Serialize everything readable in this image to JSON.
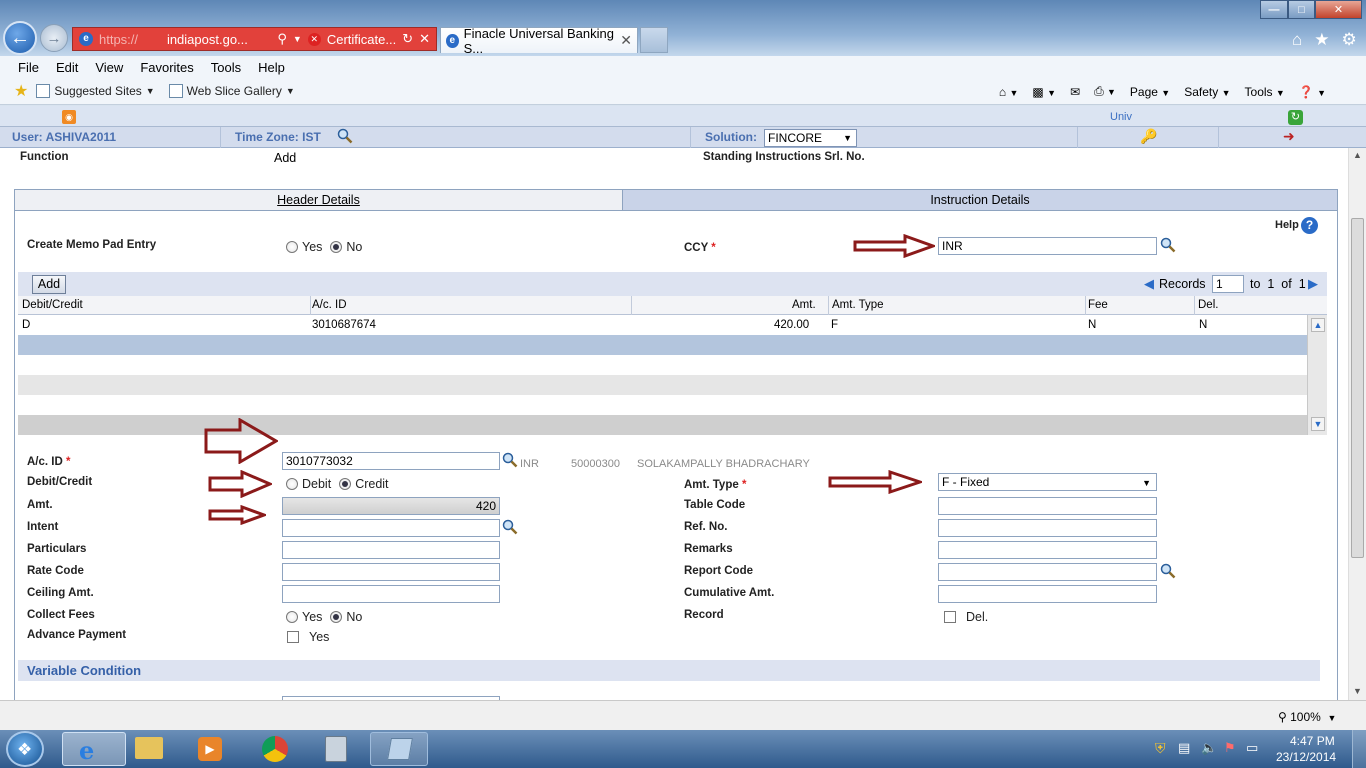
{
  "browser": {
    "address_url_faded": "https://",
    "address_url_host": "indiapost.go...",
    "cert_label": "Certificate...",
    "active_tab_title": "Finacle Universal Banking S...",
    "menu": [
      "File",
      "Edit",
      "View",
      "Favorites",
      "Tools",
      "Help"
    ],
    "favorites": [
      "Suggested Sites",
      "Web Slice Gallery"
    ],
    "commands": [
      "Page",
      "Safety",
      "Tools"
    ],
    "zoom": "100%"
  },
  "app": {
    "univ_link": "Univ",
    "user_label": "User: ASHIVA2011",
    "timezone_label": "Time Zone: IST",
    "solution_label": "Solution:",
    "solution_value": "FINCORE"
  },
  "form": {
    "function_label": "Function",
    "function_value": "Add",
    "si_srl_label": "Standing Instructions Srl. No.",
    "tabs": {
      "header": "Header Details",
      "instruction": "Instruction Details"
    },
    "help_label": "Help",
    "memo_label": "Create Memo Pad Entry",
    "memo_yes": "Yes",
    "memo_no": "No",
    "ccy_label": "CCY",
    "ccy_value": "INR",
    "add_button": "Add",
    "records_label": "Records",
    "records_value": "1",
    "records_to": "to",
    "records_from_num": "1",
    "records_of": "of",
    "records_total": "1",
    "grid_headers": {
      "debit_credit": "Debit/Credit",
      "acid": "A/c. ID",
      "amt": "Amt.",
      "amt_type": "Amt. Type",
      "fee": "Fee",
      "del": "Del."
    },
    "grid_row": {
      "debit_credit": "D",
      "acid": "3010687674",
      "amt": "420.00",
      "amt_type": "F",
      "fee": "N",
      "del": "N"
    },
    "acid_label": "A/c. ID",
    "acid_value": "3010773032",
    "acid_ccy": "INR",
    "acid_sol": "50000300",
    "acid_name": "SOLAKAMPALLY BHADRACHARY",
    "dc_label": "Debit/Credit",
    "dc_debit": "Debit",
    "dc_credit": "Credit",
    "amt_label": "Amt.",
    "amt_value": "420",
    "intent_label": "Intent",
    "particulars_label": "Particulars",
    "rate_code_label": "Rate Code",
    "ceiling_label": "Ceiling Amt.",
    "collect_fees_label": "Collect Fees",
    "collect_yes": "Yes",
    "collect_no": "No",
    "advance_label": "Advance Payment",
    "advance_yes": "Yes",
    "amt_type_label": "Amt. Type",
    "amt_type_value": "F - Fixed",
    "table_code_label": "Table Code",
    "ref_no_label": "Ref. No.",
    "remarks_label": "Remarks",
    "report_code_label": "Report Code",
    "cumulative_label": "Cumulative Amt.",
    "record_label": "Record",
    "record_del": "Del.",
    "variable_condition": "Variable Condition"
  },
  "taskbar": {
    "time": "4:47 PM",
    "date": "23/12/2014"
  },
  "colors": {
    "arrow": "#8b1a1a",
    "accent": "#3b6fc2",
    "section_bg": "#dde3f1"
  }
}
